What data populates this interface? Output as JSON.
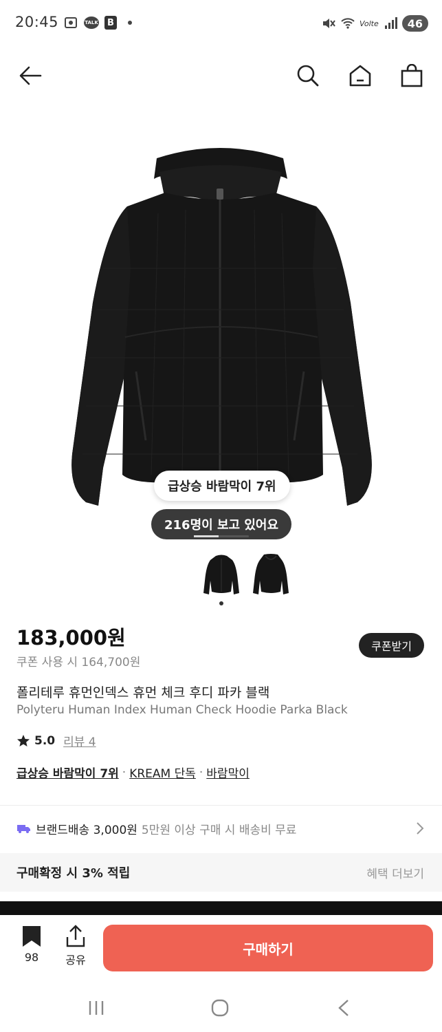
{
  "status_bar": {
    "time": "20:45",
    "battery": "46",
    "network": "Volte"
  },
  "product": {
    "price": "183,000원",
    "coupon_price": "쿠폰 사용 시 164,700원",
    "coupon_button": "쿠폰받기",
    "name_ko": "폴리테루 휴먼인덱스 휴먼 체크 후디 파카 블랙",
    "name_en": "Polyteru Human Index Human Check Hoodie Parka Black",
    "rating": "5.0",
    "review_link": "리뷰 4",
    "tags": [
      "급상승 바람막이 7위",
      "KREAM 단독",
      "바람막이"
    ],
    "image_badge_rank": "급상승 바람막이 7위",
    "image_badge_viewers": "216명이 보고 있어요",
    "image_color": "#151515"
  },
  "shipping": {
    "label": "브랜드배송 3,000원",
    "note": "5만원 이상 구매 시 배송비 무료"
  },
  "benefit": {
    "label": "구매확정 시 3% 적립",
    "more": "혜택 더보기"
  },
  "action_bar": {
    "bookmark_count": "98",
    "share_label": "공유",
    "buy_label": "구매하기",
    "buy_color": "#ef6253"
  },
  "icons": {
    "back": "back-arrow-icon",
    "search": "search-icon",
    "home": "home-icon",
    "bag": "shopping-bag-icon",
    "star": "star-icon",
    "truck": "truck-icon",
    "chevron": "chevron-right-icon",
    "bookmark": "bookmark-icon",
    "share": "share-icon"
  }
}
